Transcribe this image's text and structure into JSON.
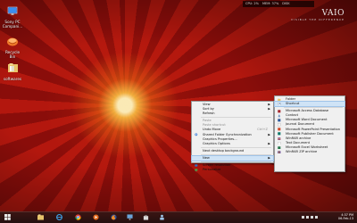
{
  "system_monitor": {
    "cpu": "CPU: 2%",
    "mem": "MEM: 37%",
    "disk": "DISK"
  },
  "brand": {
    "logo": "VAIO",
    "tagline": "VISIBLE THE DIFFERENCE"
  },
  "desktop_icons": [
    {
      "label_line1": "Sony PC",
      "label_line2": "Compani...",
      "icon": "monitor-icon"
    },
    {
      "label_line1": "Recycle Bin",
      "label_line2": "",
      "icon": "recycle-bin-icon"
    },
    {
      "label_line1": "softwares",
      "label_line2": "",
      "icon": "folder-icon"
    }
  ],
  "context_menu": {
    "items": [
      {
        "label": "View",
        "has_arrow": true
      },
      {
        "label": "Sort by",
        "has_arrow": true
      },
      {
        "label": "Refresh"
      },
      {
        "label": "Paste",
        "disabled": true
      },
      {
        "label": "Paste shortcut",
        "disabled": true
      },
      {
        "label": "Undo Move",
        "shortcut": "Ctrl+Z"
      },
      {
        "label": "Shared Folder Synchronization",
        "has_arrow": true
      },
      {
        "label": "Graphics Properties..."
      },
      {
        "label": "Graphics Options",
        "has_arrow": true
      },
      {
        "label": "Next desktop background"
      },
      {
        "label": "New",
        "has_arrow": true
      },
      {
        "label": "Screen resolution"
      },
      {
        "label": "Personalize"
      }
    ]
  },
  "new_submenu": {
    "items": [
      {
        "label": "Folder",
        "icon": "folder-icon"
      },
      {
        "label": "Shortcut",
        "icon": "shortcut-icon"
      },
      {
        "label": "Microsoft Access Database",
        "icon": "access-icon"
      },
      {
        "label": "Contact",
        "icon": "contact-icon"
      },
      {
        "label": "Microsoft Word Document",
        "icon": "word-icon"
      },
      {
        "label": "Journal Document",
        "icon": "journal-icon"
      },
      {
        "label": "Microsoft PowerPoint Presentation",
        "icon": "powerpoint-icon"
      },
      {
        "label": "Microsoft Publisher Document",
        "icon": "publisher-icon"
      },
      {
        "label": "WinRAR archive",
        "icon": "winrar-icon"
      },
      {
        "label": "Text Document",
        "icon": "text-document-icon"
      },
      {
        "label": "Microsoft Excel Worksheet",
        "icon": "excel-icon"
      },
      {
        "label": "WinRAR ZIP archive",
        "icon": "winrar-zip-icon"
      }
    ]
  },
  "taskbar": {
    "clock_time": "4:37 PM",
    "clock_date": "06-Feb-13"
  },
  "colors": {
    "wallpaper_dark": "#8a0d0a",
    "wallpaper_ray": "#b3170e",
    "menu_bg": "#f0f0f0",
    "highlight": "#cfe3f6"
  }
}
